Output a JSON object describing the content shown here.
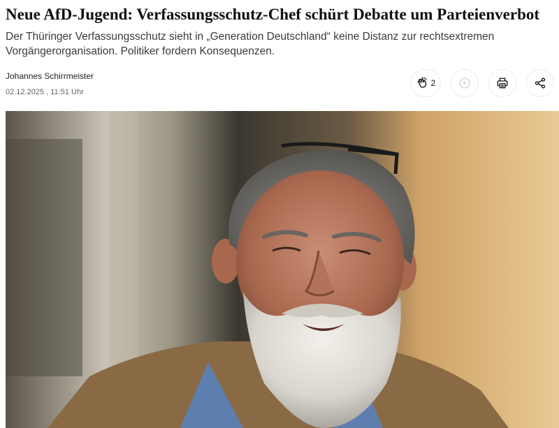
{
  "article": {
    "headline": "Neue AfD-Jugend: Verfassungsschutz-Chef schürt Debatte um Parteienverbot",
    "teaser": "Der Thüringer Verfassungsschutz sieht in „Generation Deutschland“ keine Distanz zur rechtsextremen Vorgängerorganisation. Politiker fordern Konsequenzen.",
    "author": "Johannes Schirrmeister",
    "date": "02.12.2025",
    "time": "11:51 Uhr"
  },
  "actions": {
    "clap_count": "2",
    "icons": [
      "clap-icon",
      "play-icon",
      "print-icon",
      "share-icon"
    ]
  },
  "hero": {
    "subject": "man-with-grey-beard-photo"
  },
  "colors": {
    "text_primary": "#111111",
    "text_secondary": "#3a3a3a",
    "meta": "#666666",
    "button_border": "#ebebeb",
    "icon_muted": "#cfcfcf"
  }
}
